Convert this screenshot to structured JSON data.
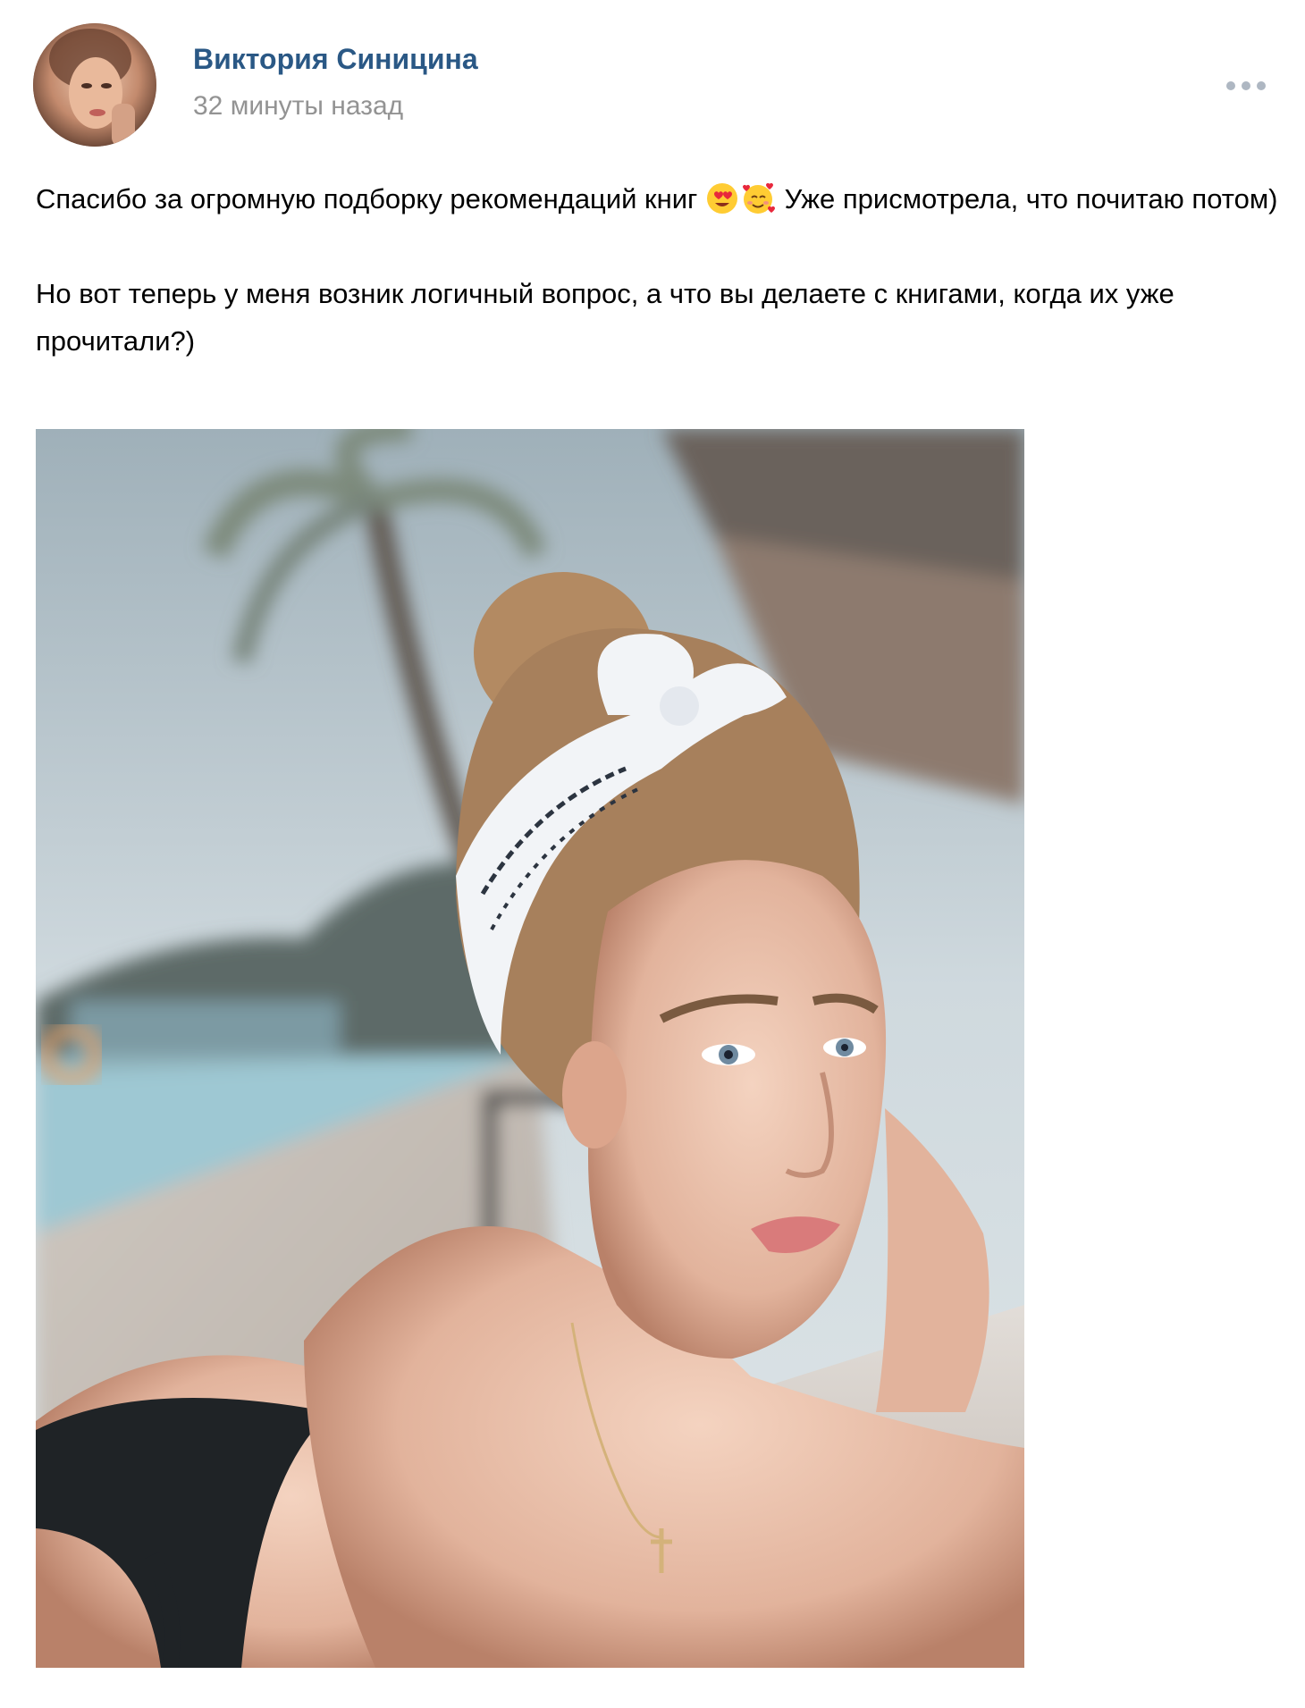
{
  "post": {
    "author": {
      "name": "Виктория Синицина",
      "avatar": "avatar"
    },
    "time": "32 минуты назад",
    "more_icon": "more-dots-icon",
    "text": {
      "paragraph1_start": "Спасибо за огромную подборку рекомендаций книг",
      "paragraph1_end": "Уже присмотрела, что почитаю потом)",
      "emojis": [
        "heart-eyes-emoji",
        "smiling-face-with-hearts-emoji"
      ],
      "paragraph2": "Но вот теперь у меня возник логичный вопрос, а что вы делаете с книгами, когда их уже прочитали?)"
    },
    "photo": {
      "subject": "photo"
    }
  },
  "colors": {
    "author_link": "#2a5885",
    "timestamp": "#939393",
    "text": "#000000",
    "more_dots": "#aeb7c2"
  }
}
